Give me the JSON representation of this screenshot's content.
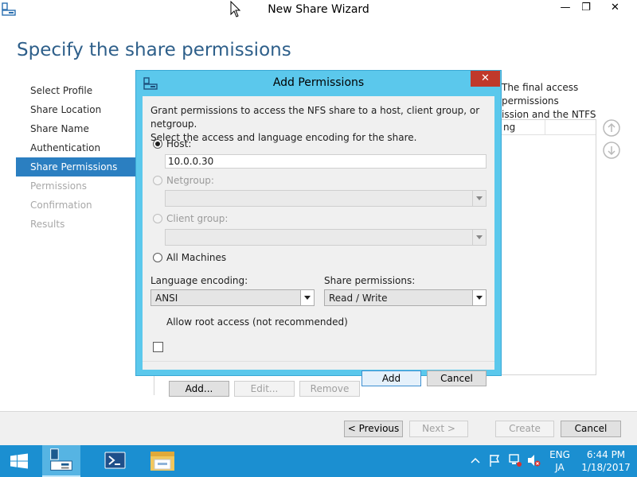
{
  "window": {
    "title": "New Share Wizard",
    "controls": {
      "minimize": "—",
      "maximize": "❐",
      "close": "✕"
    }
  },
  "page": {
    "heading": "Specify the share permissions",
    "description_line1": "The final access permissions",
    "description_line2": "ission and the NTFS",
    "list_column": "ng"
  },
  "nav": [
    {
      "label": "Select Profile",
      "state": "normal"
    },
    {
      "label": "Share Location",
      "state": "normal"
    },
    {
      "label": "Share Name",
      "state": "normal"
    },
    {
      "label": "Authentication",
      "state": "normal"
    },
    {
      "label": "Share Permissions",
      "state": "active"
    },
    {
      "label": "Permissions",
      "state": "disabled"
    },
    {
      "label": "Confirmation",
      "state": "disabled"
    },
    {
      "label": "Results",
      "state": "disabled"
    }
  ],
  "list_buttons": {
    "add": "Add...",
    "edit": "Edit...",
    "remove": "Remove"
  },
  "footer": {
    "previous": "< Previous",
    "next": "Next >",
    "create": "Create",
    "cancel": "Cancel"
  },
  "dialog": {
    "title": "Add Permissions",
    "close": "✕",
    "description_line1": "Grant permissions to access the NFS share to a host, client group, or netgroup.",
    "description_line2": "Select the access and language encoding for the share.",
    "host_label": "Host:",
    "host_value": "10.0.0.30",
    "netgroup_label": "Netgroup:",
    "client_group_label": "Client group:",
    "all_machines_label": "All Machines",
    "language_label": "Language encoding:",
    "language_value": "ANSI",
    "share_perm_label": "Share permissions:",
    "share_perm_value": "Read / Write",
    "root_access_label": "Allow root access (not recommended)",
    "add": "Add",
    "cancel": "Cancel"
  },
  "taskbar": {
    "lang_top": "ENG",
    "lang_bottom": "JA",
    "time": "6:44 PM",
    "date": "1/18/2017"
  },
  "colors": {
    "accent": "#2b7fc1",
    "dialog_frame": "#5bc8ec",
    "taskbar": "#1b8fd1",
    "close_red": "#c0392b"
  }
}
